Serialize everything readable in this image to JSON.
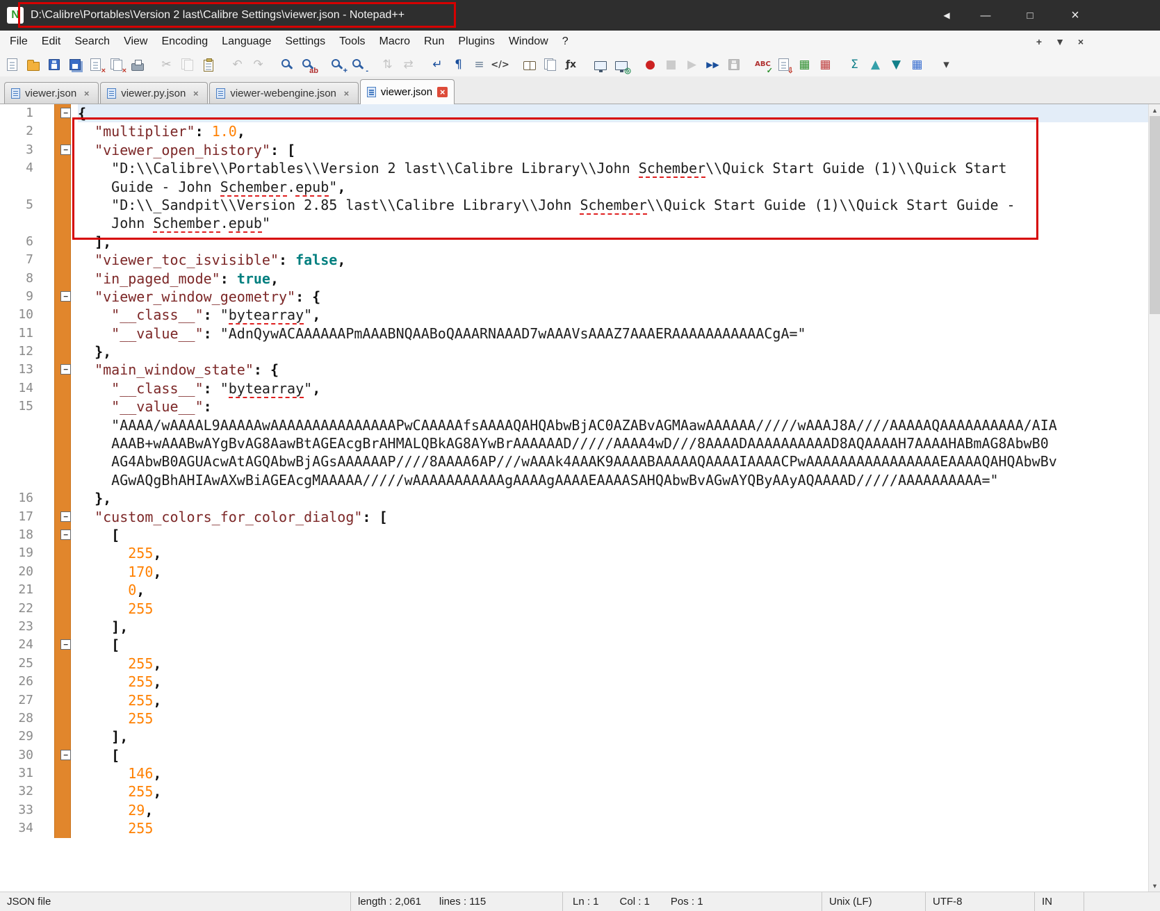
{
  "window": {
    "title": "D:\\Calibre\\Portables\\Version 2 last\\Calibre Settings\\viewer.json - Notepad++",
    "logo_glyph": "N",
    "controls": {
      "back": "◀",
      "minimize": "—",
      "maximize": "□",
      "close": "×"
    }
  },
  "menu": {
    "items": [
      "File",
      "Edit",
      "Search",
      "View",
      "Encoding",
      "Language",
      "Settings",
      "Tools",
      "Macro",
      "Run",
      "Plugins",
      "Window",
      "?"
    ],
    "right": [
      {
        "name": "new-tab-plus-icon",
        "glyph": "+"
      },
      {
        "name": "tab-list-dropdown-icon",
        "glyph": "▼"
      },
      {
        "name": "close-tab-icon",
        "glyph": "×"
      }
    ]
  },
  "toolbar": {
    "icons": [
      {
        "name": "new-file-icon",
        "kind": "page"
      },
      {
        "name": "open-file-icon",
        "kind": "folder"
      },
      {
        "name": "save-file-icon",
        "kind": "floppy"
      },
      {
        "name": "save-all-icon",
        "kind": "floppy2"
      },
      {
        "name": "close-file-icon",
        "kind": "page",
        "badge": "×",
        "badge_color": "#c0392b"
      },
      {
        "name": "close-all-icon",
        "kind": "pages",
        "badge": "×",
        "badge_color": "#c0392b"
      },
      {
        "name": "print-icon",
        "kind": "printer"
      },
      {
        "name": "cut-icon",
        "glyph": "✂",
        "color": "#555555",
        "disabled": true,
        "gap": true
      },
      {
        "name": "copy-icon",
        "kind": "pages",
        "disabled": true
      },
      {
        "name": "paste-icon",
        "kind": "clipboard"
      },
      {
        "name": "undo-icon",
        "glyph": "↶",
        "color": "#6a6a6a",
        "disabled": true,
        "gap": true
      },
      {
        "name": "redo-icon",
        "glyph": "↷",
        "color": "#6a6a6a",
        "disabled": true
      },
      {
        "name": "find-icon",
        "kind": "mag",
        "gap": true
      },
      {
        "name": "replace-icon",
        "kind": "mag",
        "badge": "ab",
        "badge_color": "#b03030"
      },
      {
        "name": "zoom-in-icon",
        "kind": "mag",
        "badge": "+",
        "badge_color": "#1a4f9c",
        "gap": true
      },
      {
        "name": "zoom-out-icon",
        "kind": "mag",
        "badge": "-",
        "badge_color": "#1a4f9c"
      },
      {
        "name": "sync-vertical-scroll-icon",
        "glyph": "⇅",
        "color": "#777777",
        "disabled": true,
        "gap": true
      },
      {
        "name": "sync-horizontal-scroll-icon",
        "glyph": "⇄",
        "color": "#777777",
        "disabled": true
      },
      {
        "name": "word-wrap-icon",
        "glyph": "↵",
        "color": "#1a4f9c",
        "gap": true
      },
      {
        "name": "show-all-characters-icon",
        "glyph": "¶",
        "color": "#1a4f9c"
      },
      {
        "name": "indent-guide-icon",
        "glyph": "≡",
        "color": "#6a7f96"
      },
      {
        "name": "show-wrap-symbol-icon",
        "glyph": "</>",
        "color": "#444444",
        "size": 13
      },
      {
        "name": "document-map-icon",
        "kind": "book",
        "gap": true
      },
      {
        "name": "document-list-icon",
        "kind": "pages"
      },
      {
        "name": "function-list-icon",
        "glyph": "ƒx",
        "color": "#333333",
        "size": 14
      },
      {
        "name": "monitor-icon",
        "kind": "monitor",
        "gap": true
      },
      {
        "name": "monitor-eye-icon",
        "kind": "monitor",
        "badge": "◎",
        "badge_color": "#2a8f5a"
      },
      {
        "name": "macro-record-icon",
        "glyph": "●",
        "color": "#cc2222",
        "gap": true
      },
      {
        "name": "macro-stop-icon",
        "glyph": "■",
        "color": "#888888",
        "disabled": true
      },
      {
        "name": "macro-play-icon",
        "glyph": "▶",
        "color": "#888888",
        "disabled": true
      },
      {
        "name": "macro-run-multiple-icon",
        "glyph": "▶▶",
        "color": "#1a4f9c",
        "size": 12
      },
      {
        "name": "macro-save-icon",
        "kind": "floppy",
        "disabled": true
      },
      {
        "name": "spell-check-abc-icon",
        "glyph": "ABC",
        "color": "#b03030",
        "size": 10,
        "badge": "✓",
        "badge_color": "#2a8f2a",
        "gap": true
      },
      {
        "name": "plugin-download-icon",
        "kind": "page",
        "badge": "⇩",
        "badge_color": "#c0392b"
      },
      {
        "name": "plugin-grid-green-icon",
        "glyph": "▦",
        "color": "#2f8f2f"
      },
      {
        "name": "plugin-grid-red-icon",
        "glyph": "▦",
        "color": "#c04040"
      },
      {
        "name": "plugin-sigma-icon",
        "glyph": "Σ",
        "color": "#12808a",
        "gap": true
      },
      {
        "name": "plugin-triangle-up-icon",
        "glyph": "▲",
        "color": "#35a0aa"
      },
      {
        "name": "plugin-triangle-down-icon",
        "glyph": "▼",
        "color": "#12808a"
      },
      {
        "name": "plugin-grid-blue-icon",
        "glyph": "▦",
        "color": "#3a6fd0"
      },
      {
        "name": "toolbar-customize-chevron-icon",
        "glyph": "▾",
        "color": "#444444",
        "gap": true
      }
    ]
  },
  "tabs": [
    {
      "label": "viewer.json",
      "active": false
    },
    {
      "label": "viewer.py.json",
      "active": false
    },
    {
      "label": "viewer-webengine.json",
      "active": false
    },
    {
      "label": "viewer.json",
      "active": true
    }
  ],
  "editor": {
    "rows": [
      {
        "n": "1",
        "f": 1,
        "cur": 1,
        "ind": 0,
        "seg": [
          [
            "p",
            "{"
          ]
        ]
      },
      {
        "n": "2",
        "ind": 2,
        "seg": [
          [
            "k",
            "\"multiplier\""
          ],
          [
            "p",
            ": "
          ],
          [
            "n",
            "1.0"
          ],
          [
            "p",
            ","
          ]
        ]
      },
      {
        "n": "3",
        "f": 1,
        "ind": 2,
        "seg": [
          [
            "k",
            "\"viewer_open_history\""
          ],
          [
            "p",
            ": ["
          ]
        ]
      },
      {
        "n": "4",
        "ind": 4,
        "seg": [
          [
            "s",
            "\"D:\\\\Calibre\\\\Portables\\\\Version 2 last\\\\Calibre Library\\\\John "
          ],
          [
            "u",
            "Schember"
          ],
          [
            "s",
            "\\\\Quick Start Guide (1)\\\\Quick Start"
          ]
        ]
      },
      {
        "ind": 4,
        "seg": [
          [
            "s",
            "Guide - John "
          ],
          [
            "u",
            "Schember"
          ],
          [
            "s",
            "."
          ],
          [
            "u",
            "epub"
          ],
          [
            "s",
            "\""
          ],
          [
            "p",
            ","
          ]
        ]
      },
      {
        "n": "5",
        "ind": 4,
        "seg": [
          [
            "s",
            "\"D:\\\\_Sandpit\\\\Version 2.85 last\\\\Calibre Library\\\\John "
          ],
          [
            "u",
            "Schember"
          ],
          [
            "s",
            "\\\\Quick Start Guide (1)\\\\Quick Start Guide -"
          ]
        ]
      },
      {
        "ind": 4,
        "seg": [
          [
            "s",
            "John "
          ],
          [
            "u",
            "Schember"
          ],
          [
            "s",
            "."
          ],
          [
            "u",
            "epub"
          ],
          [
            "s",
            "\""
          ]
        ]
      },
      {
        "n": "6",
        "ind": 2,
        "seg": [
          [
            "p",
            "],"
          ]
        ]
      },
      {
        "n": "7",
        "ind": 2,
        "seg": [
          [
            "k",
            "\"viewer_toc_isvisible\""
          ],
          [
            "p",
            ": "
          ],
          [
            "w",
            "false"
          ],
          [
            "p",
            ","
          ]
        ]
      },
      {
        "n": "8",
        "ind": 2,
        "seg": [
          [
            "k",
            "\"in_paged_mode\""
          ],
          [
            "p",
            ": "
          ],
          [
            "w",
            "true"
          ],
          [
            "p",
            ","
          ]
        ]
      },
      {
        "n": "9",
        "f": 1,
        "ind": 2,
        "seg": [
          [
            "k",
            "\"viewer_window_geometry\""
          ],
          [
            "p",
            ": {"
          ]
        ]
      },
      {
        "n": "10",
        "ind": 4,
        "seg": [
          [
            "k",
            "\"__class__\""
          ],
          [
            "p",
            ": "
          ],
          [
            "s",
            "\""
          ],
          [
            "u",
            "bytearray"
          ],
          [
            "s",
            "\""
          ],
          [
            "p",
            ","
          ]
        ]
      },
      {
        "n": "11",
        "ind": 4,
        "seg": [
          [
            "k",
            "\"__value__\""
          ],
          [
            "p",
            ": "
          ],
          [
            "s",
            "\"AdnQywACAAAAAAPmAAABNQAABoQAAARNAAAD7wAAAVsAAAZ7AAAERAAAAAAAAAAACgA=\""
          ]
        ]
      },
      {
        "n": "12",
        "ind": 2,
        "seg": [
          [
            "p",
            "},"
          ]
        ]
      },
      {
        "n": "13",
        "f": 1,
        "ind": 2,
        "seg": [
          [
            "k",
            "\"main_window_state\""
          ],
          [
            "p",
            ": {"
          ]
        ]
      },
      {
        "n": "14",
        "ind": 4,
        "seg": [
          [
            "k",
            "\"__class__\""
          ],
          [
            "p",
            ": "
          ],
          [
            "s",
            "\""
          ],
          [
            "u",
            "bytearray"
          ],
          [
            "s",
            "\""
          ],
          [
            "p",
            ","
          ]
        ]
      },
      {
        "n": "15",
        "ind": 4,
        "seg": [
          [
            "k",
            "\"__value__\""
          ],
          [
            "p",
            ":"
          ]
        ]
      },
      {
        "ind": 4,
        "seg": [
          [
            "s",
            "\"AAAA/wAAAAL9AAAAAwAAAAAAAAAAAAAAAPwCAAAAAfsAAAAQAHQAbwBjAC0AZABvAGMAawAAAAAA/////wAAAJ8A////AAAAAQAAAAAAAAAA/AIA"
          ]
        ]
      },
      {
        "ind": 4,
        "seg": [
          [
            "s",
            "AAAB+wAAABwAYgBvAG8AawBtAGEAcgBrAHMALQBkAG8AYwBrAAAAAAD/////AAAA4wD///8AAAADAAAAAAAAAAD8AQAAAAH7AAAAHABmAG8AbwB0"
          ]
        ]
      },
      {
        "ind": 4,
        "seg": [
          [
            "s",
            "AG4AbwB0AGUAcwAtAGQAbwBjAGsAAAAAAP////8AAAA6AP///wAAAk4AAAK9AAAABAAAAAQAAAAIAAAACPwAAAAAAAAAAAAAAAAEAAAAQAHQAbwBv"
          ]
        ]
      },
      {
        "ind": 4,
        "seg": [
          [
            "s",
            "AGwAQgBhAHIAwAXwBiAGEAcgMAAAAA/////wAAAAAAAAAAAgAAAAgAAAAEAAAASAHQAbwBvAGwAYQByAAyAQAAAAD/////AAAAAAAAAA=\""
          ]
        ]
      },
      {
        "n": "16",
        "ind": 2,
        "seg": [
          [
            "p",
            "},"
          ]
        ]
      },
      {
        "n": "17",
        "f": 1,
        "ind": 2,
        "seg": [
          [
            "k",
            "\"custom_colors_for_color_dialog\""
          ],
          [
            "p",
            ": ["
          ]
        ]
      },
      {
        "n": "18",
        "f": 1,
        "ind": 4,
        "seg": [
          [
            "p",
            "["
          ]
        ]
      },
      {
        "n": "19",
        "ind": 6,
        "seg": [
          [
            "n",
            "255"
          ],
          [
            "p",
            ","
          ]
        ]
      },
      {
        "n": "20",
        "ind": 6,
        "seg": [
          [
            "n",
            "170"
          ],
          [
            "p",
            ","
          ]
        ]
      },
      {
        "n": "21",
        "ind": 6,
        "seg": [
          [
            "n",
            "0"
          ],
          [
            "p",
            ","
          ]
        ]
      },
      {
        "n": "22",
        "ind": 6,
        "seg": [
          [
            "n",
            "255"
          ]
        ]
      },
      {
        "n": "23",
        "ind": 4,
        "seg": [
          [
            "p",
            "],"
          ]
        ]
      },
      {
        "n": "24",
        "f": 1,
        "ind": 4,
        "seg": [
          [
            "p",
            "["
          ]
        ]
      },
      {
        "n": "25",
        "ind": 6,
        "seg": [
          [
            "n",
            "255"
          ],
          [
            "p",
            ","
          ]
        ]
      },
      {
        "n": "26",
        "ind": 6,
        "seg": [
          [
            "n",
            "255"
          ],
          [
            "p",
            ","
          ]
        ]
      },
      {
        "n": "27",
        "ind": 6,
        "seg": [
          [
            "n",
            "255"
          ],
          [
            "p",
            ","
          ]
        ]
      },
      {
        "n": "28",
        "ind": 6,
        "seg": [
          [
            "n",
            "255"
          ]
        ]
      },
      {
        "n": "29",
        "ind": 4,
        "seg": [
          [
            "p",
            "],"
          ]
        ]
      },
      {
        "n": "30",
        "f": 1,
        "ind": 4,
        "seg": [
          [
            "p",
            "["
          ]
        ]
      },
      {
        "n": "31",
        "ind": 6,
        "seg": [
          [
            "n",
            "146"
          ],
          [
            "p",
            ","
          ]
        ]
      },
      {
        "n": "32",
        "ind": 6,
        "seg": [
          [
            "n",
            "255"
          ],
          [
            "p",
            ","
          ]
        ]
      },
      {
        "n": "33",
        "ind": 6,
        "seg": [
          [
            "n",
            "29"
          ],
          [
            "p",
            ","
          ]
        ]
      },
      {
        "n": "34",
        "ind": 6,
        "seg": [
          [
            "n",
            "255"
          ]
        ]
      }
    ]
  },
  "colors": {
    "key": "#7c2727",
    "string": "#1e1e1e",
    "number": "#ff8000",
    "keyword": "#007f7f",
    "punct": "#0d0d0d",
    "current_line": "#e3edf8",
    "change_bar": "#e1862c",
    "annotation": "#d60000",
    "accent_blue": "#1a4f9c"
  },
  "status": {
    "doctype": "JSON file",
    "length": "length : 2,061",
    "lines": "lines : 115",
    "ln": "Ln : 1",
    "col": "Col : 1",
    "pos": "Pos : 1",
    "eol": "Unix (LF)",
    "encoding": "UTF-8",
    "mode": "IN"
  }
}
